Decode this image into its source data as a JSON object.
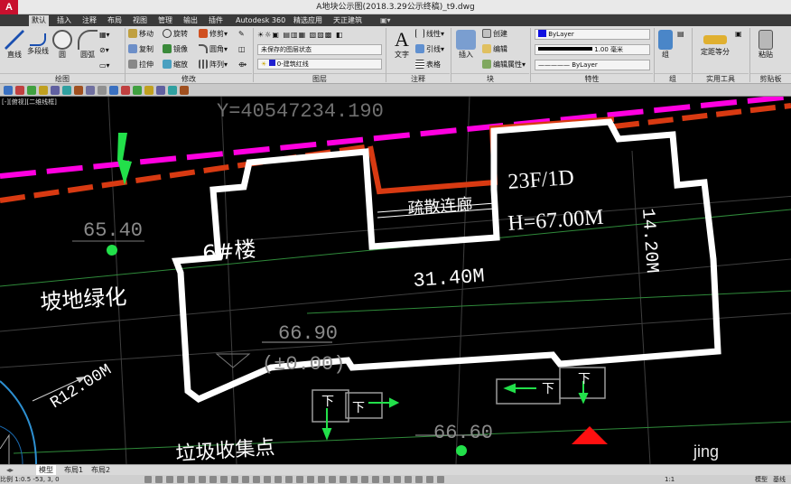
{
  "titlebar": {
    "logo": "A",
    "title": "A地块公示图(2018.3.29公示终稿)_t9.dwg"
  },
  "tabs": [
    "默认",
    "插入",
    "注释",
    "布局",
    "视图",
    "管理",
    "输出",
    "插件",
    "Autodesk 360",
    "精选应用",
    "天正建筑"
  ],
  "ribbon": {
    "draw": {
      "title": "绘图",
      "line": "直线",
      "polyline": "多段线",
      "circle": "圆",
      "arc": "圆弧"
    },
    "modify": {
      "title": "修改",
      "move": "移动",
      "rotate": "旋转",
      "trim": "修剪",
      "copy": "复制",
      "mirror": "镜像",
      "fillet": "圆角",
      "stretch": "拉伸",
      "scale": "缩放",
      "array": "阵列"
    },
    "layers": {
      "title": "图层",
      "layer_state": "未保存的图层状态",
      "current_layer": "0-建筑红线"
    },
    "annotation": {
      "title": "注释",
      "text": "文字",
      "linear": "线性",
      "leader": "引线",
      "table": "表格"
    },
    "block": {
      "title": "块",
      "insert": "插入",
      "create": "创建",
      "edit": "编辑",
      "edit_attr": "编辑属性"
    },
    "properties": {
      "title": "特性",
      "color": "ByLayer",
      "lineweight": "1.00 毫米",
      "linetype": "ByLayer"
    },
    "groups": {
      "title": "组",
      "group": "组"
    },
    "utilities": {
      "title": "实用工具",
      "measure": "定距等分"
    },
    "clipboard": {
      "title": "剪贴板",
      "paste": "粘贴"
    }
  },
  "viewport_label": "[-][俯视][二维线框]",
  "drawing": {
    "coord_text": "Y=40547234.190",
    "elev_1": "65.40",
    "green_area": "坡地绿化",
    "radius": "R12.00M",
    "building": "6#楼",
    "corridor": "疏散连廊",
    "floors": "23F/1D",
    "height": "H=67.00M",
    "depth": "14.20M",
    "length": "31.40M",
    "elev_2": "66.90",
    "elev_2_rel": "(±0.00)",
    "entry": "下",
    "elev_3": "66.60",
    "garbage": "垃圾收集点"
  },
  "watermark": "jing",
  "layout_tabs": [
    "模型",
    "布局1",
    "布局2"
  ],
  "statusbar": {
    "coords": "比例 1:0.5  -53, 3, 0",
    "scale": "1:1",
    "model": "模型",
    "workspace": "基线"
  },
  "colors": {
    "magenta": "#ff00e0",
    "redline": "#d83a12",
    "green": "#22e04a"
  }
}
